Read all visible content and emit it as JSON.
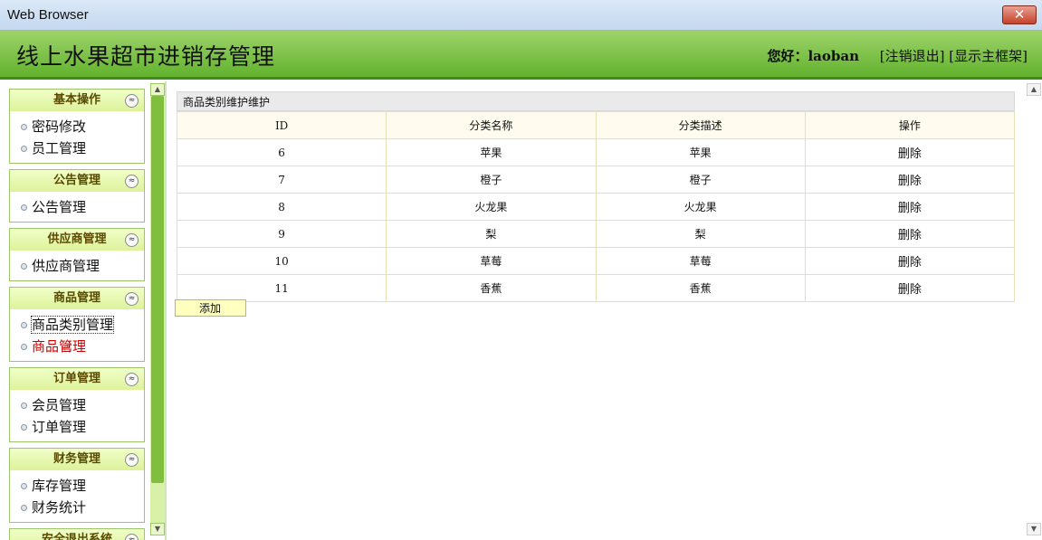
{
  "window": {
    "title": "Web Browser",
    "close_label": "✕"
  },
  "header": {
    "app_title": "线上水果超市进销存管理",
    "greeting": "您好：",
    "username": "laoban",
    "logout_link": "[注销退出]",
    "mainframe_link": "[显示主框架]"
  },
  "sidebar": {
    "groups": [
      {
        "title": "基本操作",
        "items": [
          {
            "label": "密码修改"
          },
          {
            "label": "员工管理"
          }
        ]
      },
      {
        "title": "公告管理",
        "items": [
          {
            "label": "公告管理"
          }
        ]
      },
      {
        "title": "供应商管理",
        "items": [
          {
            "label": "供应商管理"
          }
        ]
      },
      {
        "title": "商品管理",
        "items": [
          {
            "label": "商品类别管理"
          },
          {
            "label": "商品管理"
          }
        ]
      },
      {
        "title": "订单管理",
        "items": [
          {
            "label": "会员管理"
          },
          {
            "label": "订单管理"
          }
        ]
      },
      {
        "title": "财务管理",
        "items": [
          {
            "label": "库存管理"
          },
          {
            "label": "财务统计"
          }
        ]
      },
      {
        "title": "安全退出系统",
        "items": []
      }
    ],
    "collapse_glyph": "≈"
  },
  "main": {
    "panel_title": "商品类别维护维护",
    "columns": [
      "ID",
      "分类名称",
      "分类描述",
      "操作"
    ],
    "rows": [
      {
        "id": "6",
        "name": "苹果",
        "desc": "苹果",
        "op": "删除"
      },
      {
        "id": "7",
        "name": "橙子",
        "desc": "橙子",
        "op": "删除"
      },
      {
        "id": "8",
        "name": "火龙果",
        "desc": "火龙果",
        "op": "删除"
      },
      {
        "id": "9",
        "name": "梨",
        "desc": "梨",
        "op": "删除"
      },
      {
        "id": "10",
        "name": "草莓",
        "desc": "草莓",
        "op": "删除"
      },
      {
        "id": "11",
        "name": "香蕉",
        "desc": "香蕉",
        "op": "删除"
      }
    ],
    "add_button": "添加"
  }
}
